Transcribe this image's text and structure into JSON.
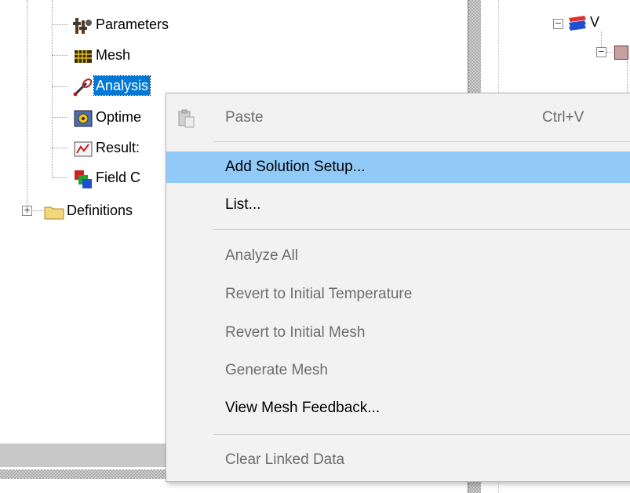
{
  "tree": {
    "items": [
      {
        "label": "Parameters",
        "icon": "parameters-icon"
      },
      {
        "label": "Mesh",
        "icon": "mesh-icon"
      },
      {
        "label": "Analysis",
        "icon": "analysis-icon",
        "selected": true
      },
      {
        "label": "Optime",
        "icon": "optimetrics-icon"
      },
      {
        "label": "Result:",
        "icon": "results-icon"
      },
      {
        "label": "Field C",
        "icon": "field-calculator-icon"
      }
    ],
    "definitions": {
      "label": "Definitions",
      "icon": "folder-icon",
      "expander": "+"
    }
  },
  "right_tree": {
    "item_label": "V",
    "expander": "−"
  },
  "context_menu": {
    "items": [
      {
        "label": "Paste",
        "shortcut": "Ctrl+V",
        "enabled": false,
        "icon": "paste-icon"
      },
      {
        "label": "Add Solution Setup...",
        "enabled": true,
        "highlighted": true
      },
      {
        "label": "List...",
        "enabled": true
      },
      {
        "label": "Analyze All",
        "enabled": false
      },
      {
        "label": "Revert to Initial Temperature",
        "enabled": false
      },
      {
        "label": "Revert to Initial Mesh",
        "enabled": false
      },
      {
        "label": "Generate Mesh",
        "enabled": false
      },
      {
        "label": "View Mesh Feedback...",
        "enabled": true
      },
      {
        "label": "Clear Linked Data",
        "enabled": false
      }
    ]
  },
  "colors": {
    "selection": "#0078d7",
    "menu_highlight": "#91c9f7",
    "menu_background": "#f2f2f2",
    "disabled_text": "#6d6d6d"
  }
}
